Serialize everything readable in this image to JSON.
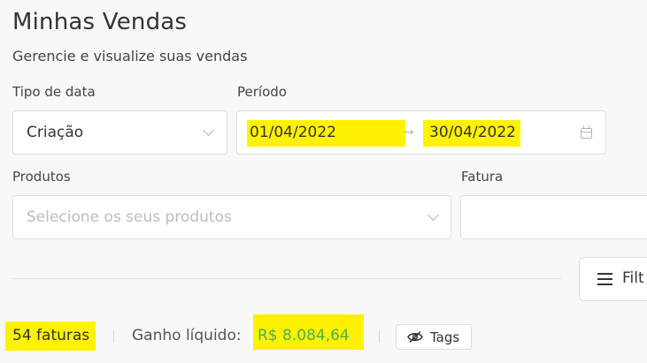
{
  "header": {
    "title": "Minhas Vendas",
    "subtitle": "Gerencie e visualize suas vendas"
  },
  "filters": {
    "date_type": {
      "label": "Tipo de data",
      "value": "Criação"
    },
    "period": {
      "label": "Período",
      "start": "01/04/2022",
      "separator": "→",
      "end": "30/04/2022"
    },
    "products": {
      "label": "Produtos",
      "placeholder": "Selecione os seus produtos"
    },
    "invoice": {
      "label": "Fatura",
      "value": ""
    },
    "filter_button": {
      "label": "Filt"
    }
  },
  "summary": {
    "invoices": "54 faturas",
    "net_label": "Ganho líquido:",
    "net_value": "R$ 8.084,64",
    "tags_label": "Tags"
  },
  "colors": {
    "highlight": "#fff200",
    "money": "#4caf50"
  },
  "icons": [
    "chevron-down-icon",
    "calendar-icon",
    "menu-icon",
    "eye-off-icon"
  ]
}
